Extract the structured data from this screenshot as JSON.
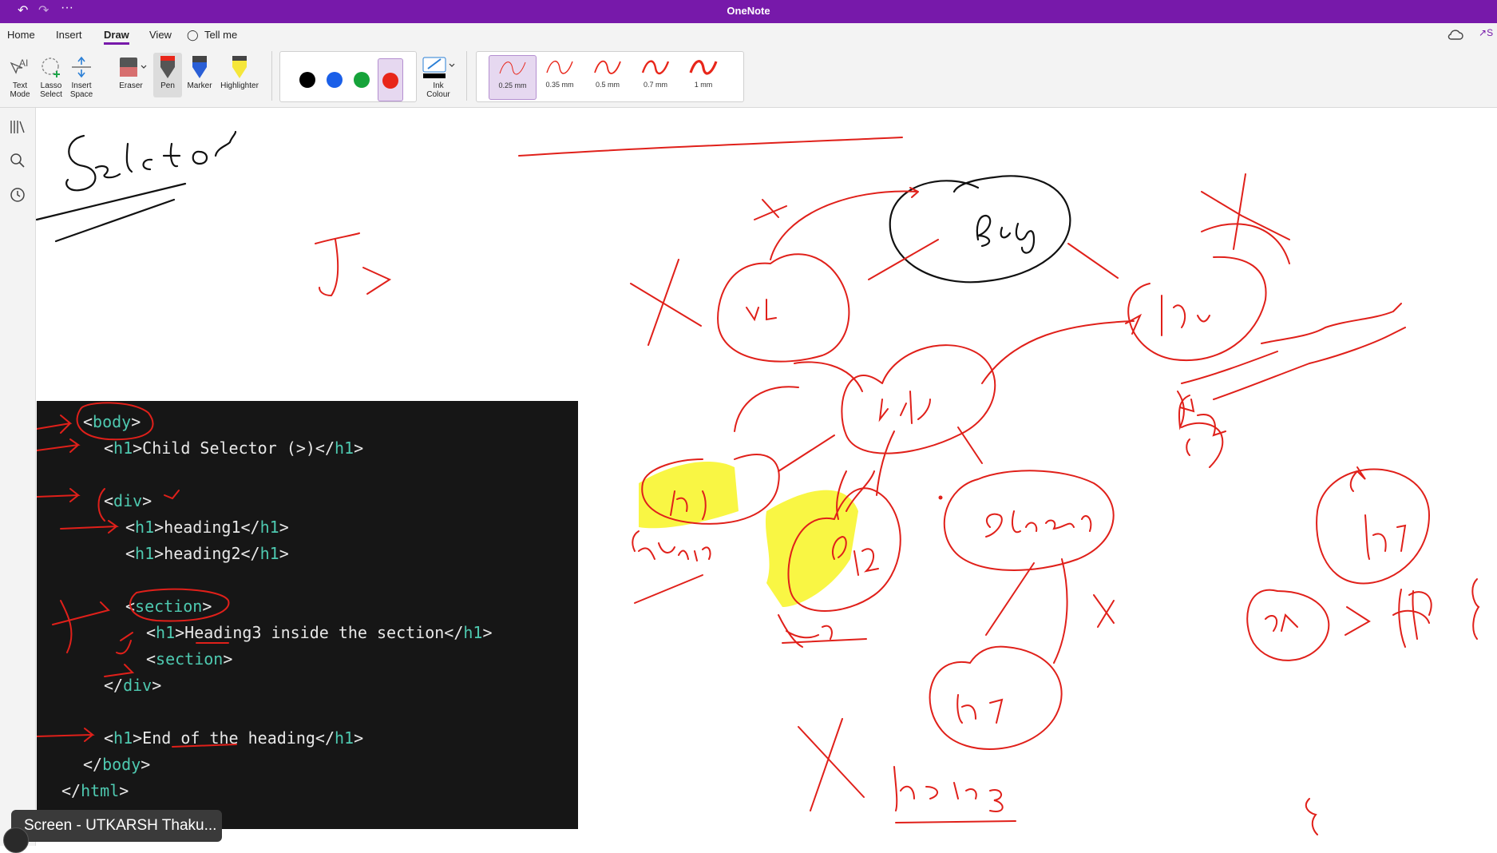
{
  "titlebar": {
    "title": "OneNote",
    "more": "···"
  },
  "menu": {
    "home": "Home",
    "insert": "Insert",
    "draw": "Draw",
    "view": "View",
    "tell_me": "Tell me"
  },
  "ribbon": {
    "text_mode": [
      "Text",
      "Mode"
    ],
    "lasso_select": [
      "Lasso",
      "Select"
    ],
    "insert_space": [
      "Insert",
      "Space"
    ],
    "eraser": "Eraser",
    "pen": "Pen",
    "marker": "Marker",
    "highlighter": "Highlighter",
    "ink_colour": [
      "Ink",
      "Colour"
    ],
    "colors": [
      "#000000",
      "#1a5fe8",
      "#16a33a",
      "#e8261a"
    ],
    "selected_color": "#e8261a",
    "thickness": [
      "0.25 mm",
      "0.35 mm",
      "0.5 mm",
      "0.7 mm",
      "1 mm"
    ],
    "selected_thickness": "0.25 mm",
    "share_label": "S"
  },
  "code": {
    "l1": [
      "<",
      "body",
      ">"
    ],
    "l2": [
      "<",
      "h1",
      ">Child Selector (>)</",
      "h1",
      ">"
    ],
    "l3": [
      "<",
      "div",
      ">"
    ],
    "l4": [
      "<",
      "h1",
      ">heading1</",
      "h1",
      ">"
    ],
    "l5": [
      "<",
      "h1",
      ">heading2</",
      "h1",
      ">"
    ],
    "l6": [
      "<",
      "section",
      ">"
    ],
    "l7": [
      "<",
      "h1",
      ">Heading3 inside the section</",
      "h1",
      ">"
    ],
    "l8": [
      "<",
      "section",
      ">"
    ],
    "l9": [
      "</",
      "div",
      ">"
    ],
    "l10": [
      "<",
      "h1",
      ">End of the heading</",
      "h1",
      ">"
    ],
    "l11": [
      "</",
      "body",
      ">"
    ],
    "l12": [
      "</",
      "html",
      ">"
    ]
  },
  "toast": {
    "label": "Screen - UTKARSH Thaku..."
  }
}
